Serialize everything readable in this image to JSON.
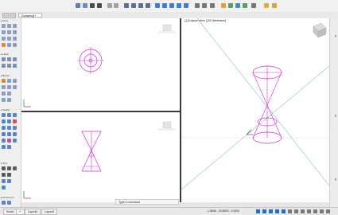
{
  "document_tab": {
    "label": "Drawing1*"
  },
  "viewport3": {
    "title": "[-] [Custom View ] [2D Wireframe]"
  },
  "command_line": {
    "placeholder": "Type a command"
  },
  "status_tabs": [
    {
      "label": "Model"
    },
    {
      "label": "Layout1"
    },
    {
      "label": "Layout2"
    }
  ],
  "status_coords": "-1.5846 , 26.8525 , 0.0000",
  "colors": {
    "drawing": "#d42bd4",
    "accent": "#1f6fd1"
  }
}
